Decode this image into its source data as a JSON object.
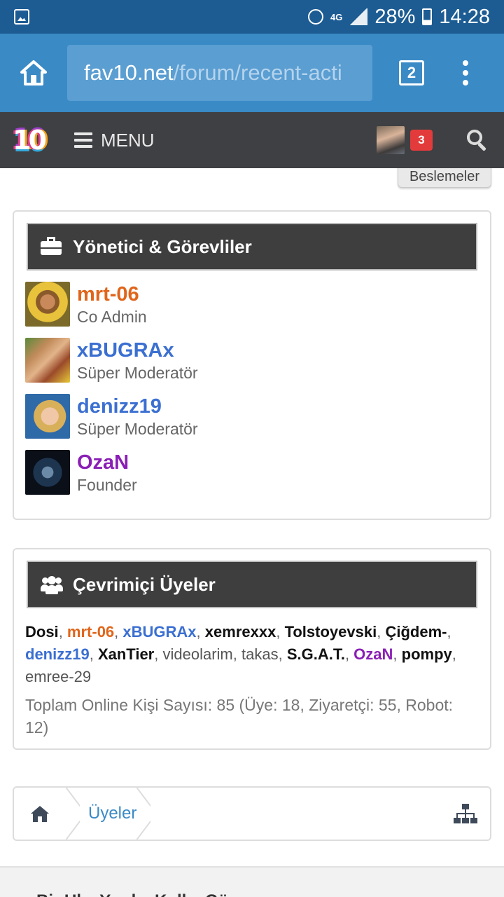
{
  "status_bar": {
    "network": "4G",
    "battery": "28%",
    "time": "14:28"
  },
  "browser": {
    "url_host": "fav10.net",
    "url_path": "/forum/recent-acti",
    "tab_count": "2"
  },
  "navbar": {
    "logo_text": "10",
    "menu_label": "MENU",
    "notification_count": "3"
  },
  "feeds_tab": "Beslemeler",
  "staff_panel": {
    "title": "Yönetici & Görevliler",
    "members": [
      {
        "name": "mrt-06",
        "role": "Co Admin",
        "color": "#e0651a"
      },
      {
        "name": "xBUGRAx",
        "role": "Süper Moderatör",
        "color": "#3b6fd1"
      },
      {
        "name": "denizz19",
        "role": "Süper Moderatör",
        "color": "#3b6fd1"
      },
      {
        "name": "OzaN",
        "role": "Founder",
        "color": "#8a1fb5"
      }
    ]
  },
  "online_panel": {
    "title": "Çevrimiçi Üyeler",
    "users": [
      "Dosi",
      "mrt-06",
      "xBUGRAx",
      "xemrexxx",
      "Tolstoyevski",
      "Çiğdem-",
      "denizz19",
      "XanTier",
      "videolarim",
      "takas",
      "S.G.A.T.",
      "OzaN",
      "pompy",
      "emree-29"
    ],
    "separator": ", ",
    "total_text": "Toplam Online Kişi Sayısı: 85 (Üye: 18, Ziyaretçi: 55, Robot: 12)"
  },
  "breadcrumb": {
    "label": "Üyeler"
  },
  "footer": {
    "text": "Bir Ul... Yard... Kull... Gö... r..."
  }
}
